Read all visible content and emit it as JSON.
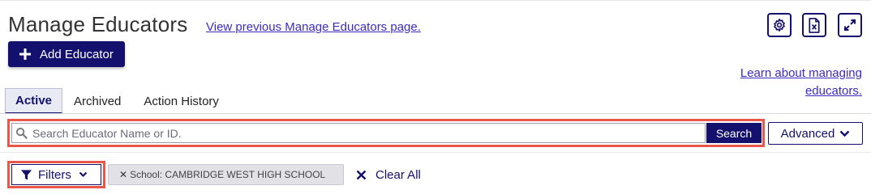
{
  "header": {
    "title": "Manage Educators",
    "previous_link": "View previous Manage Educators page.",
    "add_button": "Add Educator",
    "learn_link": "Learn about managing educators."
  },
  "toolbar_icons": [
    "settings-icon",
    "excel-export-icon",
    "expand-icon"
  ],
  "tabs": [
    {
      "label": "Active",
      "active": true
    },
    {
      "label": "Archived",
      "active": false
    },
    {
      "label": "Action History",
      "active": false
    }
  ],
  "search": {
    "placeholder": "Search Educator Name or ID.",
    "value": "",
    "button": "Search",
    "advanced": "Advanced"
  },
  "filters": {
    "button": "Filters",
    "chips": [
      {
        "label": "School: CAMBRIDGE WEST HIGH SCHOOL"
      }
    ],
    "clear_all": "Clear All"
  },
  "colors": {
    "primary": "#14106e",
    "link": "#3b2bbf",
    "highlight": "#e8574a"
  }
}
